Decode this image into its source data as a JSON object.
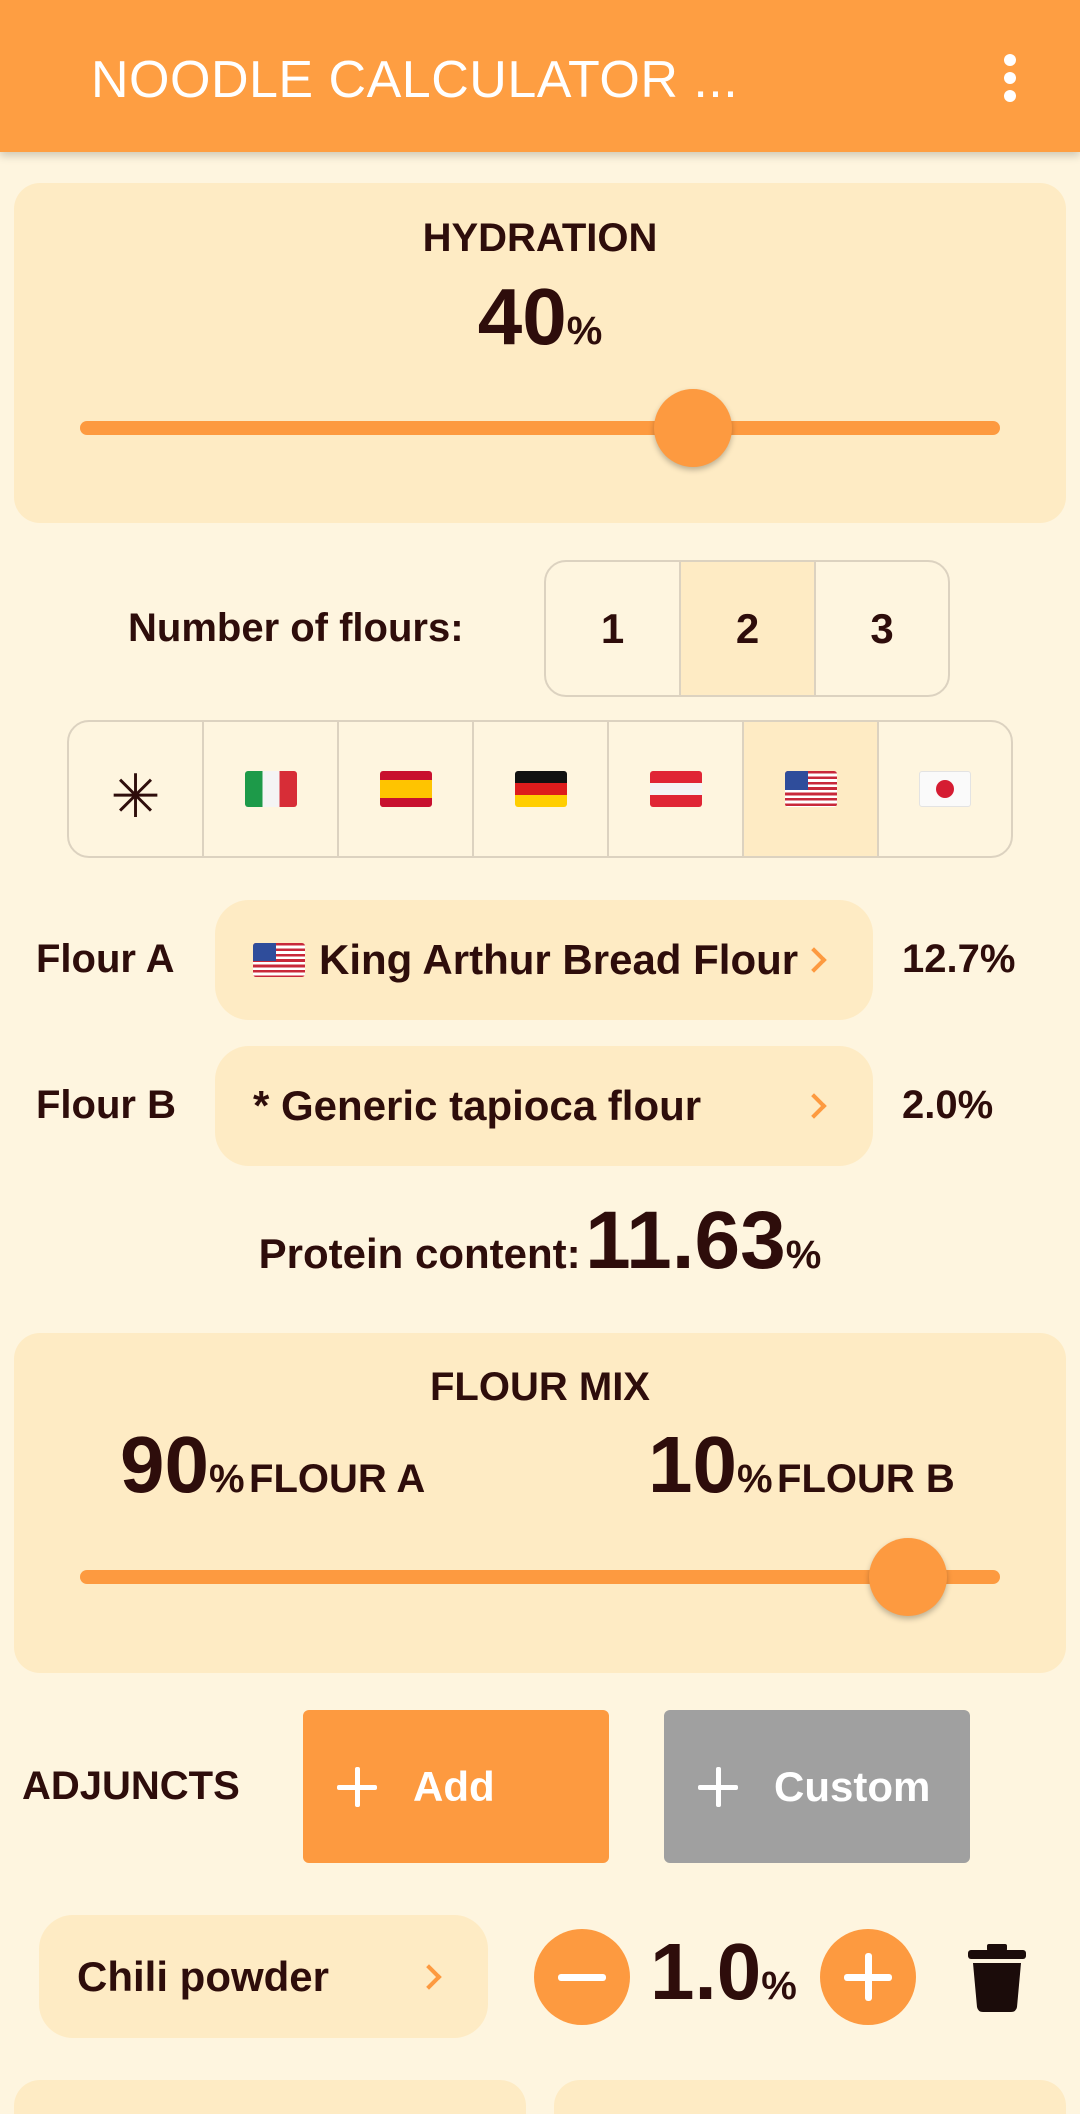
{
  "appbar": {
    "title": "NOODLE CALCULATOR ...",
    "menu_icon": "more-vert-icon"
  },
  "hydration": {
    "label": "HYDRATION",
    "value": "40",
    "unit": "%",
    "slider_fraction": 0.66
  },
  "flours_count": {
    "label": "Number of flours:",
    "options": [
      "1",
      "2",
      "3"
    ],
    "selected": "2"
  },
  "country_filter": {
    "options": [
      "all-icon",
      "italy-flag-icon",
      "spain-flag-icon",
      "germany-flag-icon",
      "austria-flag-icon",
      "usa-flag-icon",
      "japan-flag-icon"
    ],
    "all_symbol": "✳",
    "selected": "usa-flag-icon"
  },
  "flour_a": {
    "label": "Flour A",
    "name": "King Arthur Bread Flour",
    "protein": "12.7%"
  },
  "flour_b": {
    "label": "Flour B",
    "name": "* Generic tapioca flour",
    "protein": "2.0%"
  },
  "protein": {
    "label": "Protein content:",
    "value": "11.63",
    "unit": "%"
  },
  "flour_mix": {
    "label": "FLOUR MIX",
    "a_value": "90",
    "a_unit": "%",
    "a_label": "FLOUR A",
    "b_value": "10",
    "b_unit": "%",
    "b_label": "FLOUR B",
    "slider_fraction": 0.9
  },
  "adjuncts": {
    "label": "ADJUNCTS",
    "add_label": "Add",
    "custom_label": "Custom",
    "items": [
      {
        "name": "Chili powder",
        "value": "1.0",
        "unit": "%"
      }
    ]
  },
  "colors": {
    "accent": "#fd9a40",
    "card": "#feebc4",
    "background": "#fef5df",
    "text": "#2e0d0b",
    "disabled": "#a0a0a0"
  }
}
